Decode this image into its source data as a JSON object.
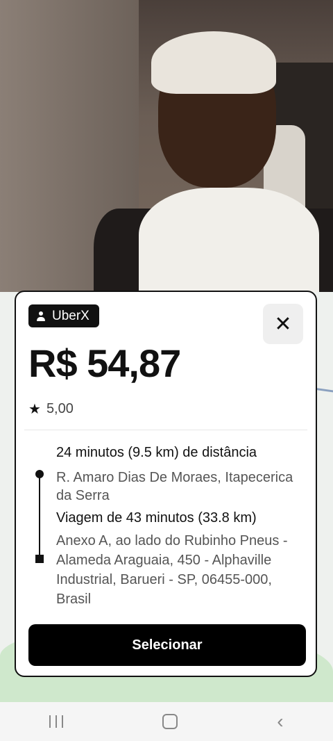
{
  "ride": {
    "badge_label": "UberX",
    "price": "R$ 54,87",
    "rating": "5,00",
    "pickup_eta": "24 minutos (9.5 km) de distância",
    "pickup_address": "R. Amaro Dias De Moraes, Itapecerica da Serra",
    "trip_duration": "Viagem de 43 minutos (33.8 km)",
    "destination_address": "Anexo A, ao lado do Rubinho Pneus - Alameda Araguaia, 450 - Alphaville Industrial, Barueri - SP, 06455-000, Brasil",
    "select_label": "Selecionar",
    "close_glyph": "✕",
    "star_glyph": "★"
  },
  "icons": {
    "badge": "person-icon",
    "close": "close-icon",
    "rating": "star-icon",
    "nav": [
      "recent-apps-icon",
      "home-icon",
      "back-icon"
    ]
  },
  "colors": {
    "primary": "#000000",
    "card_bg": "#ffffff",
    "close_bg": "#efefef"
  }
}
